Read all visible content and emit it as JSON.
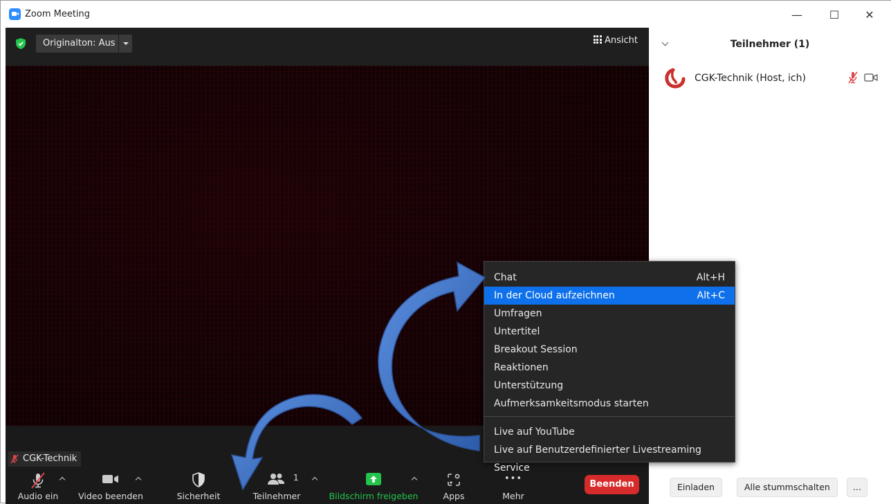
{
  "window": {
    "title": "Zoom Meeting",
    "minimize_glyph": "—",
    "maximize_glyph": "☐",
    "close_glyph": "✕"
  },
  "topbar": {
    "original_sound": "Originalton: Aus",
    "view_label": "Ansicht"
  },
  "video": {
    "name_tag": "CGK-Technik"
  },
  "toolbar": {
    "audio": "Audio ein",
    "video": "Video beenden",
    "security": "Sicherheit",
    "participants": "Teilnehmer",
    "participant_count": "1",
    "share": "Bildschirm freigeben",
    "apps": "Apps",
    "more": "Mehr",
    "more_glyph": "•••",
    "end": "Beenden"
  },
  "panel": {
    "title": "Teilnehmer (1)",
    "participants": [
      {
        "name": "CGK-Technik (Host, ich)"
      }
    ],
    "invite": "Einladen",
    "mute_all": "Alle stummschalten",
    "more": "..."
  },
  "menu": {
    "items": [
      {
        "label": "Chat",
        "shortcut": "Alt+H"
      },
      {
        "label": "In der Cloud aufzeichnen",
        "shortcut": "Alt+C"
      },
      {
        "label": "Umfragen",
        "shortcut": ""
      },
      {
        "label": "Untertitel",
        "shortcut": ""
      },
      {
        "label": "Breakout Session",
        "shortcut": ""
      },
      {
        "label": "Reaktionen",
        "shortcut": ""
      },
      {
        "label": "Unterstützung",
        "shortcut": ""
      },
      {
        "label": "Aufmerksamkeitsmodus starten",
        "shortcut": ""
      },
      {
        "label": "Live auf YouTube",
        "shortcut": ""
      },
      {
        "label": "Live auf Benutzerdefinierter Livestreaming Service",
        "shortcut": ""
      }
    ],
    "active_index": 1
  },
  "colors": {
    "accent": "#0e71eb",
    "end_red": "#d72b2b",
    "share_green": "#23c44b",
    "arrow_blue": "#3a6fc4"
  }
}
